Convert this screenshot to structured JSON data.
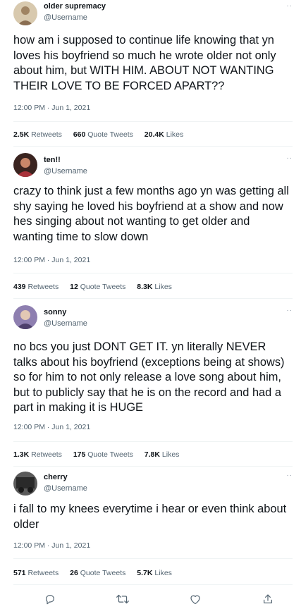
{
  "tweets": [
    {
      "name": "older supremacy",
      "handle": "@Username",
      "text": "how am i supposed to continue life knowing that yn loves his boyfriend so much he wrote older not only about him, but WITH HIM. ABOUT NOT WANTING THEIR LOVE TO BE FORCED APART??",
      "time": "12:00 PM · Jun 1, 2021",
      "retweets": "2.5K",
      "retweets_label": "Retweets",
      "quotes": "660",
      "quotes_label": "Quote Tweets",
      "likes": "20.4K",
      "likes_label": "Likes",
      "avatar_color": "#c9b79a"
    },
    {
      "name": "ten!!",
      "handle": "@Username",
      "text": "crazy to think just a few months ago yn was getting all shy saying he loved his boyfriend at a show and now hes singing about not wanting to get older and wanting time to slow down",
      "time": "12:00 PM · Jun 1, 2021",
      "retweets": "439",
      "retweets_label": "Retweets",
      "quotes": "12",
      "quotes_label": "Quote Tweets",
      "likes": "8.3K",
      "likes_label": "Likes",
      "avatar_color": "#a8323a"
    },
    {
      "name": "sonny",
      "handle": "@Username",
      "text": "no bcs you just DONT GET IT. yn literally NEVER talks about his boyfriend (exceptions being at shows) so for him to not only release a love song about him, but to publicly say that he is on the record and had a part in making it is HUGE",
      "time": "12:00 PM · Jun 1, 2021",
      "retweets": "1.3K",
      "retweets_label": "Retweets",
      "quotes": "175",
      "quotes_label": "Quote Tweets",
      "likes": "7.8K",
      "likes_label": "Likes",
      "avatar_color": "#6a5a8c"
    },
    {
      "name": "cherry",
      "handle": "@Username",
      "text": "i fall to my knees everytime i hear or even think about older",
      "time": "12:00 PM · Jun 1, 2021",
      "retweets": "571",
      "retweets_label": "Retweets",
      "quotes": "26",
      "quotes_label": "Quote Tweets",
      "likes": "5.7K",
      "likes_label": "Likes",
      "avatar_color": "#2e2e2e"
    }
  ],
  "more_glyph": "··",
  "actions": [
    "reply-icon",
    "retweet-icon",
    "like-icon",
    "share-icon"
  ],
  "colors": {
    "text": "#0f1419",
    "secondary": "#536471",
    "divider": "#eff3f4"
  }
}
